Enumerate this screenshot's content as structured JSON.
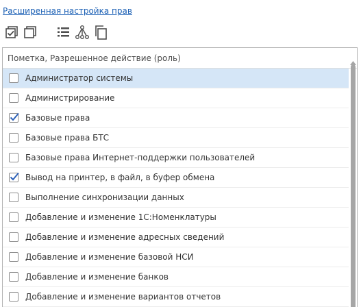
{
  "header": {
    "title_link": "Расширенная настройка прав"
  },
  "toolbar": {
    "buttons": [
      {
        "name": "check-all-icon"
      },
      {
        "name": "uncheck-all-icon"
      },
      {
        "name": "list-view-icon"
      },
      {
        "name": "tree-view-icon"
      },
      {
        "name": "copy-icon"
      }
    ]
  },
  "table": {
    "column_header": "Пометка, Разрешенное действие (роль)",
    "rows": [
      {
        "label": "Администратор системы",
        "checked": false,
        "selected": true
      },
      {
        "label": "Администрирование",
        "checked": false,
        "selected": false
      },
      {
        "label": "Базовые права",
        "checked": true,
        "selected": false
      },
      {
        "label": "Базовые права БТС",
        "checked": false,
        "selected": false
      },
      {
        "label": "Базовые права Интернет-поддержки пользователей",
        "checked": false,
        "selected": false
      },
      {
        "label": "Вывод на принтер, в файл, в буфер обмена",
        "checked": true,
        "selected": false
      },
      {
        "label": "Выполнение синхронизации данных",
        "checked": false,
        "selected": false
      },
      {
        "label": "Добавление и изменение 1С:Номенклатуры",
        "checked": false,
        "selected": false
      },
      {
        "label": "Добавление и изменение адресных сведений",
        "checked": false,
        "selected": false
      },
      {
        "label": "Добавление и изменение базовой НСИ",
        "checked": false,
        "selected": false
      },
      {
        "label": "Добавление и изменение банков",
        "checked": false,
        "selected": false
      },
      {
        "label": "Добавление и изменение вариантов отчетов",
        "checked": false,
        "selected": false
      }
    ]
  },
  "colors": {
    "link": "#1a5fb4",
    "selected_row": "#d5e6f7",
    "checkmark": "#2f62b8"
  }
}
